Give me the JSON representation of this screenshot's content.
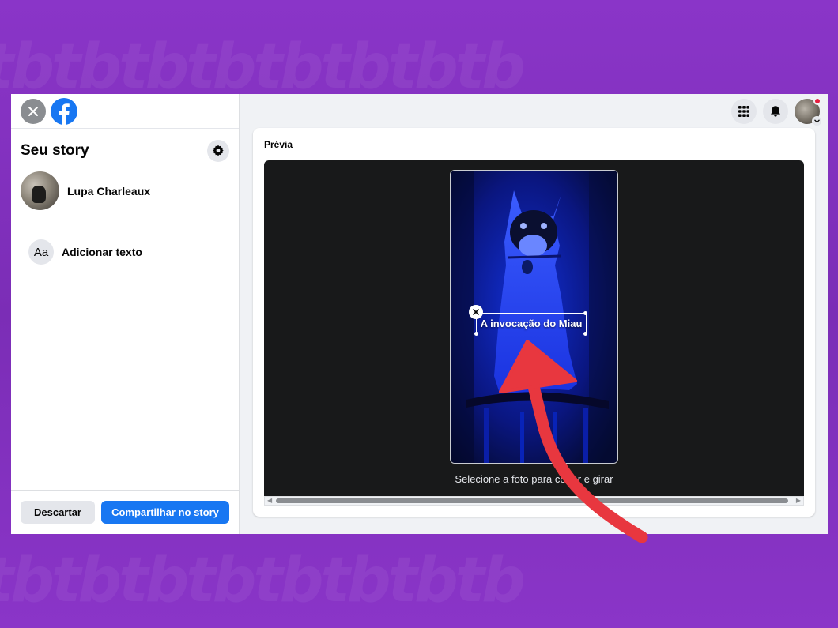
{
  "sidebar": {
    "title": "Seu story",
    "user_name": "Lupa Charleaux",
    "add_text_icon": "Aa",
    "add_text_label": "Adicionar texto",
    "discard_label": "Descartar",
    "share_label": "Compartilhar no story"
  },
  "preview": {
    "label": "Prévia",
    "story_text": "A invocação do Miau",
    "hint": "Selecione a foto para cortar e girar"
  },
  "colors": {
    "brand": "#1877f2",
    "annotation_arrow": "#e8373f",
    "background": "#7a2fb8"
  },
  "icons": [
    "close-icon",
    "facebook-logo-icon",
    "gear-icon",
    "menu-grid-icon",
    "bell-icon",
    "chevron-down-icon",
    "remove-text-icon"
  ],
  "watermark": "tbtbtbtbtbtbtbtb"
}
